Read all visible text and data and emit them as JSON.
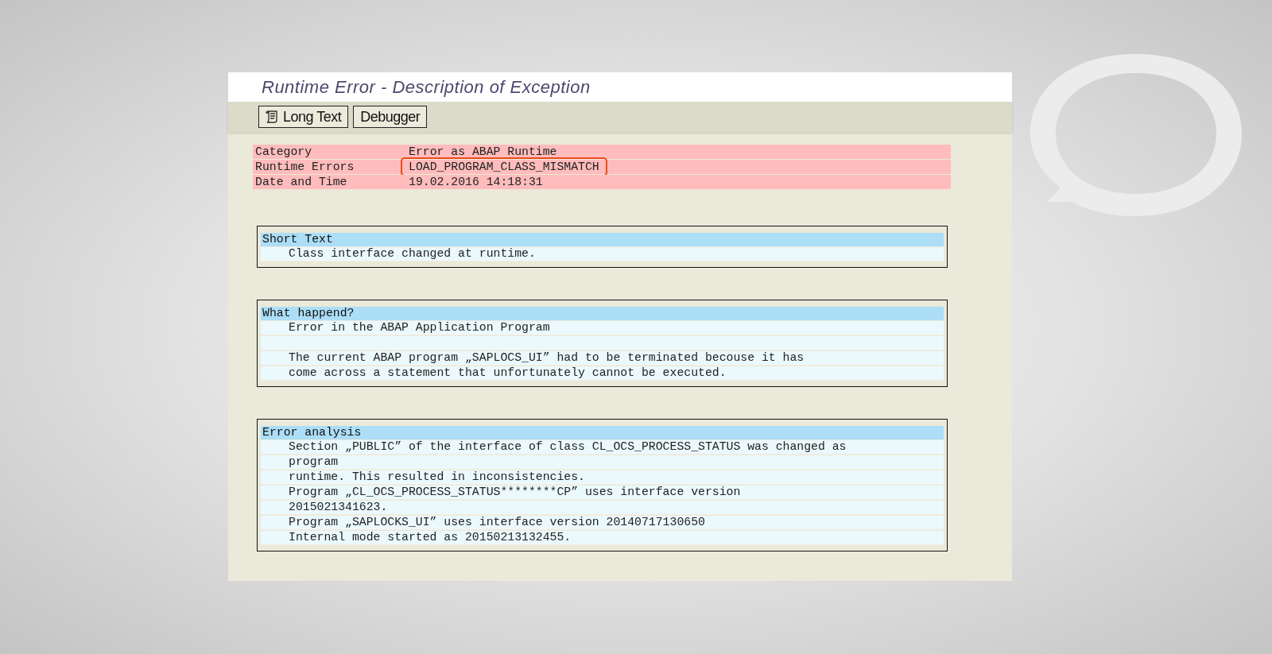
{
  "window": {
    "title": "Runtime Error - Description of Exception"
  },
  "toolbar": {
    "buttons": [
      {
        "label": "Long Text",
        "kind": "with_icon"
      },
      {
        "label": "Debugger",
        "kind": "plain"
      }
    ]
  },
  "header_rows": [
    {
      "label": "Category",
      "value": "Error as ABAP Runtime",
      "highlighted": false
    },
    {
      "label": "Runtime Errors",
      "value": "LOAD_PROGRAM_CLASS_MISMATCH",
      "highlighted": true
    },
    {
      "label": "Date and Time",
      "value": "19.02.2016 14:18:31",
      "highlighted": false
    }
  ],
  "sections": [
    {
      "title": "Short Text",
      "lines": [
        {
          "kind": "text",
          "text": "Class interface changed at runtime."
        }
      ]
    },
    {
      "title": "What happend?",
      "lines": [
        {
          "kind": "text",
          "text": "Error in the ABAP Application Program"
        },
        {
          "kind": "blank"
        },
        {
          "kind": "text",
          "text": "The current ABAP program „SAPLOCS_UI” had to be terminated becouse it has"
        },
        {
          "kind": "text",
          "text": "come across a statement that unfortunately cannot be executed."
        }
      ]
    },
    {
      "title": "Error analysis",
      "lines": [
        {
          "kind": "text",
          "text": "Section „PUBLIC” of the interface of class CL_OCS_PROCESS_STATUS was changed as"
        },
        {
          "kind": "text",
          "text": "program"
        },
        {
          "kind": "text",
          "text": "runtime. This resulted in inconsistencies."
        },
        {
          "kind": "text",
          "text": "Program „CL_OCS_PROCESS_STATUS********CP” uses interface version"
        },
        {
          "kind": "text",
          "text": "2015021341623."
        },
        {
          "kind": "text",
          "text": "Program „SAPLOCKS_UI” uses interface version 20140717130650"
        },
        {
          "kind": "text",
          "text": "Internal mode started as 20150213132455."
        }
      ]
    }
  ]
}
